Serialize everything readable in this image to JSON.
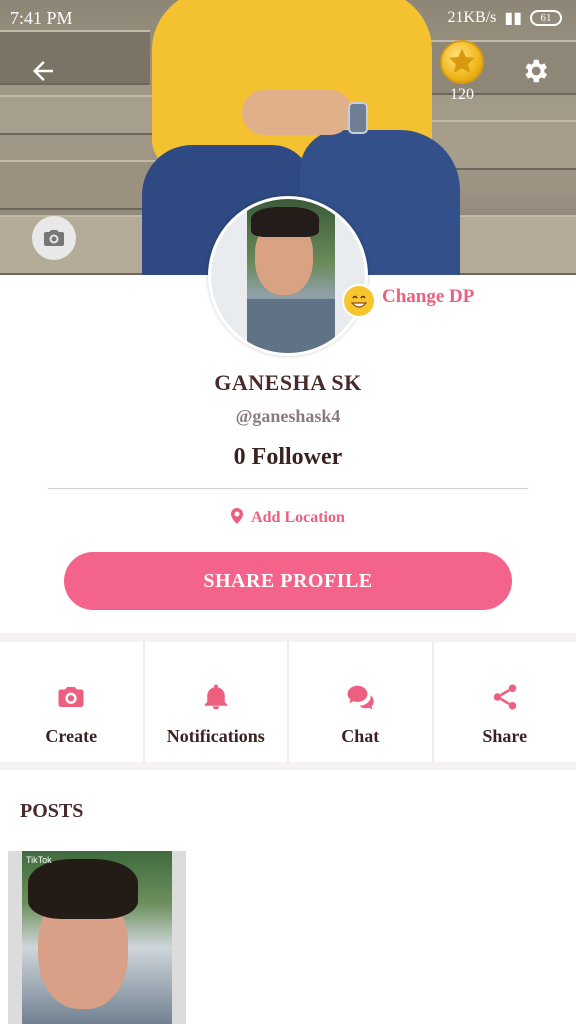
{
  "status": {
    "time": "7:41 PM",
    "network": "21KB/s",
    "battery": "61"
  },
  "header": {
    "coins": "120"
  },
  "profile": {
    "change_dp_label": "Change DP",
    "name": "GANESHA SK",
    "handle": "@ganeshask4",
    "followers": "0 Follower",
    "location_label": "Add Location",
    "share_label": "SHARE PROFILE"
  },
  "actions": [
    {
      "label": "Create",
      "icon": "camera-icon"
    },
    {
      "label": "Notifications",
      "icon": "bell-icon"
    },
    {
      "label": "Chat",
      "icon": "chat-icon"
    },
    {
      "label": "Share",
      "icon": "share-icon"
    }
  ],
  "posts": {
    "title": "POSTS",
    "items": [
      {
        "watermark": "TikTok"
      }
    ]
  },
  "colors": {
    "accent": "#f4638a",
    "text": "#3a2222"
  }
}
